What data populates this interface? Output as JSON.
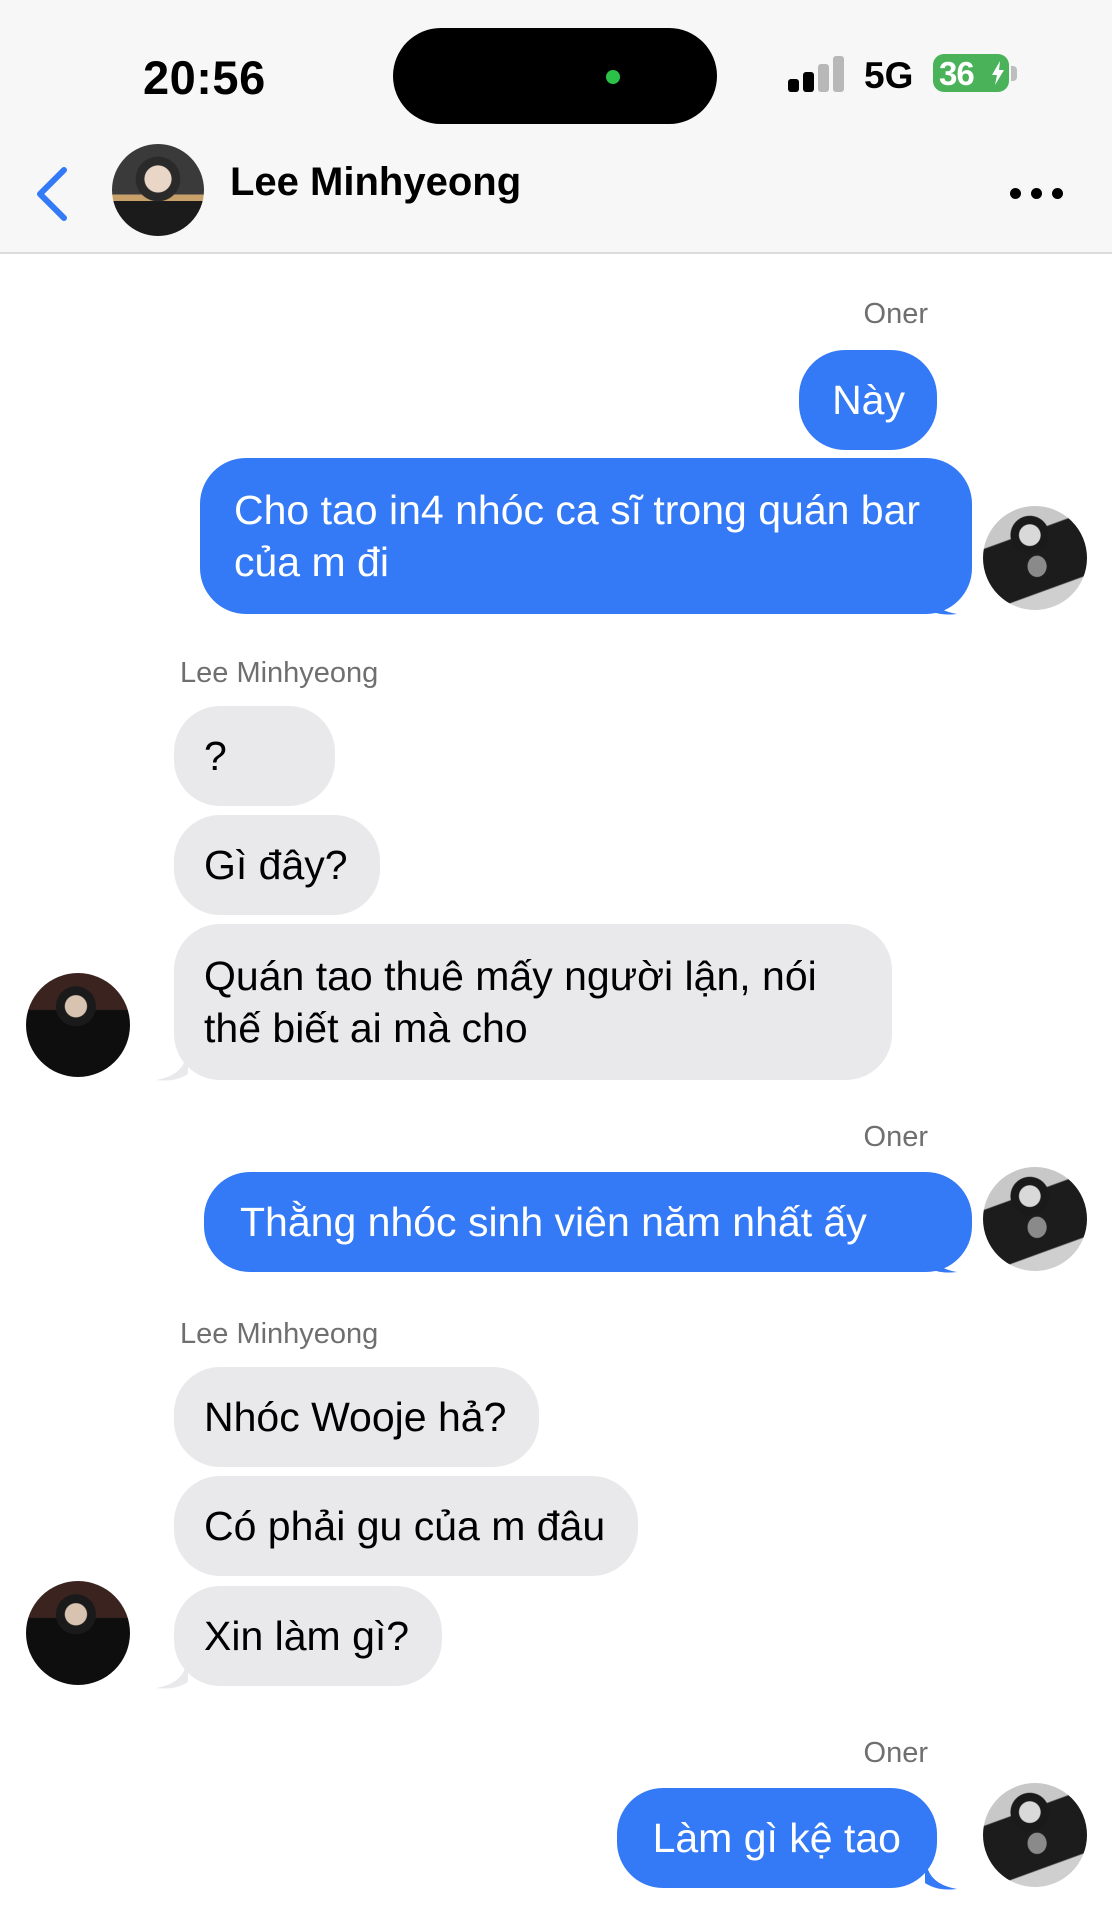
{
  "status_bar": {
    "time": "20:56",
    "network": "5G",
    "battery": "36",
    "battery_color": "#4ab35a"
  },
  "header": {
    "contact_name": "Lee Minhyeong",
    "back_icon": "chevron-left-icon",
    "more_icon": "ellipsis-icon",
    "accent_color": "#3479f6"
  },
  "messages": [
    {
      "sender": "Oner",
      "direction": "outgoing",
      "texts": [
        "Này",
        "Cho tao in4 nhóc ca sĩ trong quán bar của m đi"
      ]
    },
    {
      "sender": "Lee Minhyeong",
      "direction": "incoming",
      "texts": [
        "?",
        "Gì đây?",
        "Quán tao thuê mấy người lận, nói thế biết ai mà cho"
      ]
    },
    {
      "sender": "Oner",
      "direction": "outgoing",
      "texts": [
        "Thằng nhóc sinh viên năm nhất ấy"
      ]
    },
    {
      "sender": "Lee Minhyeong",
      "direction": "incoming",
      "texts": [
        "Nhóc Wooje hả?",
        "Có phải gu của m đâu",
        "Xin làm gì?"
      ]
    },
    {
      "sender": "Oner",
      "direction": "outgoing",
      "texts": [
        "Làm gì kệ tao"
      ]
    }
  ],
  "colors": {
    "outgoing_bubble": "#3479f6",
    "incoming_bubble": "#e9e9eb"
  }
}
